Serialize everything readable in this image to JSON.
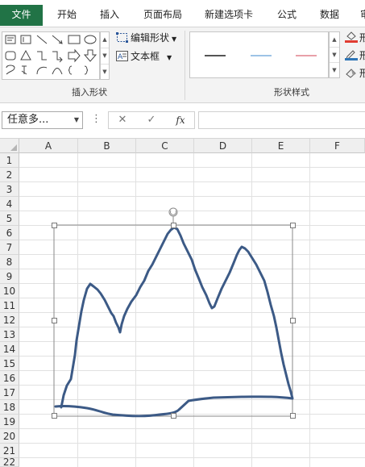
{
  "ribbon": {
    "tabs": [
      {
        "label": "文件"
      },
      {
        "label": "开始"
      },
      {
        "label": "插入"
      },
      {
        "label": "页面布局"
      },
      {
        "label": "新建选项卡"
      },
      {
        "label": "公式"
      },
      {
        "label": "数据"
      },
      {
        "label": "审"
      }
    ],
    "insert_shapes": {
      "edit_shape_label": "编辑形状",
      "text_box_label": "文本框",
      "group_label": "插入形状"
    },
    "shape_styles": {
      "group_label": "形状样式",
      "line_colors": [
        "#555555",
        "#9dc3e6",
        "#e8a0a8"
      ],
      "fill_label": "形",
      "outline_label": "形",
      "effects_label": "形"
    }
  },
  "formula_bar": {
    "name_box": "任意多...",
    "cancel_glyph": "✕",
    "enter_glyph": "✓",
    "fx_label": "fx",
    "formula_value": ""
  },
  "sheet": {
    "columns": [
      "A",
      "B",
      "C",
      "D",
      "E",
      "F"
    ],
    "rows": [
      "1",
      "2",
      "3",
      "4",
      "5",
      "6",
      "7",
      "8",
      "9",
      "10",
      "11",
      "12",
      "13",
      "14",
      "15",
      "16",
      "17",
      "18",
      "19",
      "20",
      "21",
      "22"
    ]
  },
  "drawing": {
    "stroke_color": "#3c5a86",
    "selection_color": "#8a8a8a"
  }
}
